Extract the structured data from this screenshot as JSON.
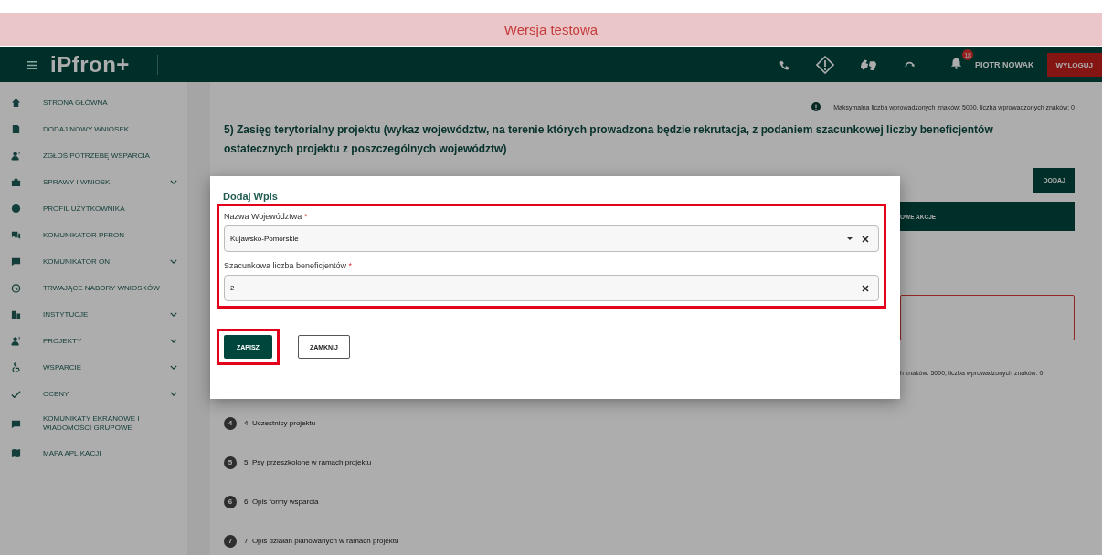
{
  "banner": {
    "text": "Wersja testowa"
  },
  "header": {
    "logo": "iPfron+",
    "notification_count": "18",
    "user": "PIOTR NOWAK",
    "logout": "WYLOGUJ"
  },
  "sidebar": {
    "items": [
      {
        "label": "STRONA GŁÓWNA",
        "kind": "link"
      },
      {
        "label": "DODAJ NOWY WNIOSEK",
        "kind": "link"
      },
      {
        "label": "ZGŁOŚ POTRZEBĘ WSPARCIA",
        "kind": "link"
      },
      {
        "label": "SPRAWY I WNIOSKI",
        "kind": "group"
      },
      {
        "label": "PROFIL UŻYTKOWNIKA",
        "kind": "link"
      },
      {
        "label": "KOMUNIKATOR PFRON",
        "kind": "link"
      },
      {
        "label": "KOMUNIKATOR ON",
        "kind": "group"
      },
      {
        "label": "TRWAJĄCE NABORY WNIOSKÓW",
        "kind": "link"
      },
      {
        "label": "INSTYTUCJE",
        "kind": "group"
      },
      {
        "label": "PROJEKTY",
        "kind": "group"
      },
      {
        "label": "WSPARCIE",
        "kind": "group"
      },
      {
        "label": "OCENY",
        "kind": "group"
      },
      {
        "label": "KOMUNIKATY EKRANOWE I WIADOMOŚCI GRUPOWE",
        "kind": "link"
      },
      {
        "label": "MAPA APLIKACJI",
        "kind": "link"
      }
    ]
  },
  "main": {
    "char_limit_note": "Maksymalna liczba wprowadzonych znaków: 5000, liczba wprowadzonych znaków: 0",
    "heading": "5) Zasięg terytorialny projektu (wykaz województw, na terenie których prowadzona będzie rekrutacja, z podaniem szacunkowej liczby beneficjentów ostatecznych projektu z poszczególnych województw)",
    "add_button": "DODAJ",
    "table_header": "OWE AKCJE",
    "char_limit_note_2": "h znaków: 5000, liczba wprowadzonych znaków: 0",
    "steps": [
      {
        "number": "4",
        "label": "4. Uczestnicy projektu"
      },
      {
        "number": "5",
        "label": "5. Psy przeszkolone w ramach projektu"
      },
      {
        "number": "6",
        "label": "6. Opis formy wsparcia"
      },
      {
        "number": "7",
        "label": "7. Opis działań planowanych w ramach projektu"
      }
    ]
  },
  "dialog": {
    "title": "Dodaj Wpis",
    "fields_highlighted": true,
    "fields": [
      {
        "label": "Nazwa Województwa",
        "required_mark": "*",
        "value": "Kujawsko-Pomorskie",
        "kind": "select"
      },
      {
        "label": "Szacunkowa liczba beneficjentów",
        "required_mark": "*",
        "value": "2",
        "kind": "text"
      }
    ],
    "buttons": [
      {
        "label": "ZAPISZ",
        "kind": "primary",
        "highlighted": true
      },
      {
        "label": "ZAMKNIJ",
        "kind": "secondary",
        "highlighted": false
      }
    ]
  }
}
